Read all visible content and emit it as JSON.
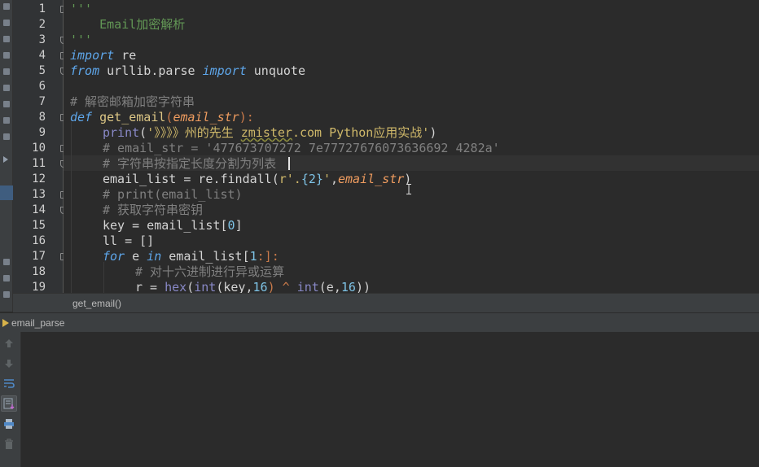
{
  "editor": {
    "line_numbers": [
      "1",
      "2",
      "3",
      "4",
      "5",
      "6",
      "7",
      "8",
      "9",
      "10",
      "11",
      "12",
      "13",
      "14",
      "15",
      "16",
      "17",
      "18",
      "19"
    ],
    "lines": {
      "l1": "'''",
      "l2": "    Email加密解析",
      "l3": "'''",
      "l4_kw": "import",
      "l4_rest": " re",
      "l5_kw1": "from",
      "l5_mid": " urllib.parse ",
      "l5_kw2": "import",
      "l5_rest": " unquote",
      "l7": "# 解密邮箱加密字符串",
      "l8_kw": "def",
      "l8_fn": "get_email",
      "l8_open": "(",
      "l8_param": "email_str",
      "l8_close": "):",
      "l9_builtin": "print",
      "l9_open": "(",
      "l9_str1": "'》》》》州的先生 ",
      "l9_str2": "zmister",
      "l9_str3": ".com Python应用实战'",
      "l9_close": ")",
      "l10": "# email_str = '477673707272 7e77727676073636692 4282a'",
      "l11": "# 字符串按指定长度分割为列表",
      "l12_a": "email_list = re.findall(",
      "l12_str1": "r'.",
      "l12_num": "{2}",
      "l12_str2": "'",
      "l12_comma": ",",
      "l12_param": "email_str",
      "l12_close": ")",
      "l13": "# print(email_list)",
      "l14": "# 获取字符串密钥",
      "l15_a": "key = email_list[",
      "l15_num": "0",
      "l15_b": "]",
      "l16": "ll = []",
      "l17_kw1": "for",
      "l17_mid": " e ",
      "l17_kw2": "in",
      "l17_rest": " email_list[",
      "l17_num": "1",
      "l17_end": ":]:",
      "l18": "# 对十六进制进行异或运算",
      "l19_a": "r = ",
      "l19_hex": "hex",
      "l19_b": "(",
      "l19_int1": "int",
      "l19_c": "(key,",
      "l19_n1": "16",
      "l19_d": ") ^ ",
      "l19_int2": "int",
      "l19_e": "(e,",
      "l19_n2": "16",
      "l19_f": "))"
    }
  },
  "breadcrumb": {
    "label": "get_email()"
  },
  "run_panel": {
    "title": "email_parse",
    "tools": [
      "arrow-up-icon",
      "arrow-down-icon",
      "soft-wrap-icon",
      "scroll-to-end-icon",
      "print-icon",
      "trash-icon"
    ]
  },
  "colors": {
    "background": "#2b2b2b",
    "keyword": "#5ea6ea",
    "string": "#d0b96a",
    "comment": "#808080",
    "docstring": "#629755"
  }
}
